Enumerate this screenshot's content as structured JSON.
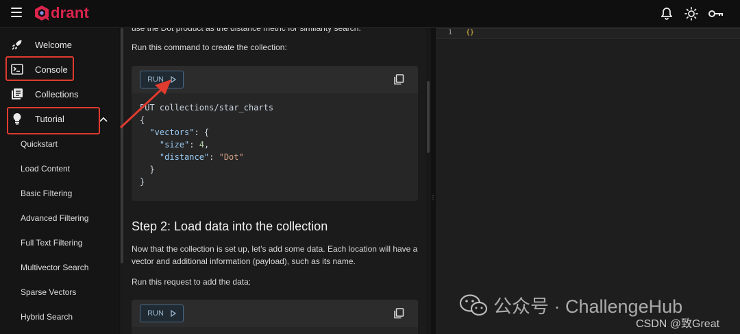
{
  "app": {
    "brand": "drant",
    "brand_color": "#dc244c",
    "top_icons": [
      "bell-icon",
      "sun-icon",
      "key-icon"
    ]
  },
  "sidebar": {
    "items": [
      {
        "label": "Welcome",
        "icon": "rocket-icon"
      },
      {
        "label": "Console",
        "icon": "terminal-icon"
      },
      {
        "label": "Collections",
        "icon": "collections-icon"
      },
      {
        "label": "Tutorial",
        "icon": "lightbulb-icon"
      }
    ],
    "tutorial_items": [
      "Quickstart",
      "Load Content",
      "Basic Filtering",
      "Advanced Filtering",
      "Full Text Filtering",
      "Multivector Search",
      "Sparse Vectors",
      "Hybrid Search"
    ]
  },
  "content": {
    "cut_line": "use the Dot product as the distance metric for similarity search.",
    "run_cmd_text": "Run this command to create the collection:",
    "run_label": "RUN",
    "code1": {
      "line1": "PUT collections/star_charts",
      "open_brace": "{",
      "vectors_key": "\"vectors\"",
      "vectors_open": ": {",
      "size_key": "\"size\"",
      "size_val": "4",
      "distance_key": "\"distance\"",
      "distance_val": "\"Dot\"",
      "inner_close": "}",
      "outer_close": "}"
    },
    "step2_title": "Step 2: Load data into the collection",
    "step2_text": "Now that the collection is set up, let’s add some data. Each location will have a vector and additional information (payload), such as its name.",
    "run_request_text": "Run this request to add the data:"
  },
  "editor": {
    "line_number": "1",
    "line_code": "{}"
  },
  "watermark": {
    "text": "公众号 · ChallengeHub",
    "csdn": "CSDN @致Great"
  },
  "annotation_color": "#e03b2f"
}
